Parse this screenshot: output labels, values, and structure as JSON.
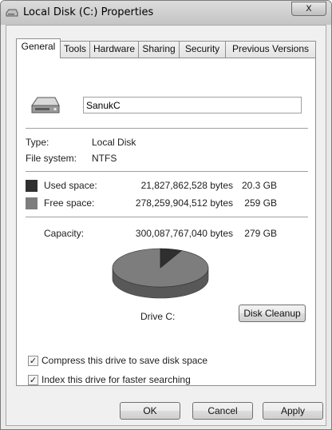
{
  "window": {
    "title": "Local Disk (C:) Properties",
    "close_label": "x"
  },
  "tabs": [
    {
      "label": "General"
    },
    {
      "label": "Tools"
    },
    {
      "label": "Hardware"
    },
    {
      "label": "Sharing"
    },
    {
      "label": "Security"
    },
    {
      "label": "Previous Versions"
    }
  ],
  "general": {
    "drive_name": "SanukC",
    "type_label": "Type:",
    "type_value": "Local Disk",
    "fs_label": "File system:",
    "fs_value": "NTFS",
    "used_label": "Used space:",
    "used_bytes": "21,827,862,528 bytes",
    "used_gb": "20.3 GB",
    "free_label": "Free space:",
    "free_bytes": "278,259,904,512 bytes",
    "free_gb": "259 GB",
    "capacity_label": "Capacity:",
    "capacity_bytes": "300,087,767,040 bytes",
    "capacity_gb": "279 GB",
    "drive_caption": "Drive C:",
    "cleanup_label": "Disk Cleanup",
    "compress_label": "Compress this drive to save disk space",
    "compress_checked": true,
    "index_label": "Index this drive for faster searching",
    "index_checked": true,
    "used_fraction": 0.0727,
    "colors": {
      "used": "#2f2f2f",
      "free": "#7d7d7d"
    }
  },
  "footer": {
    "ok_label": "OK",
    "cancel_label": "Cancel",
    "apply_label": "Apply"
  }
}
